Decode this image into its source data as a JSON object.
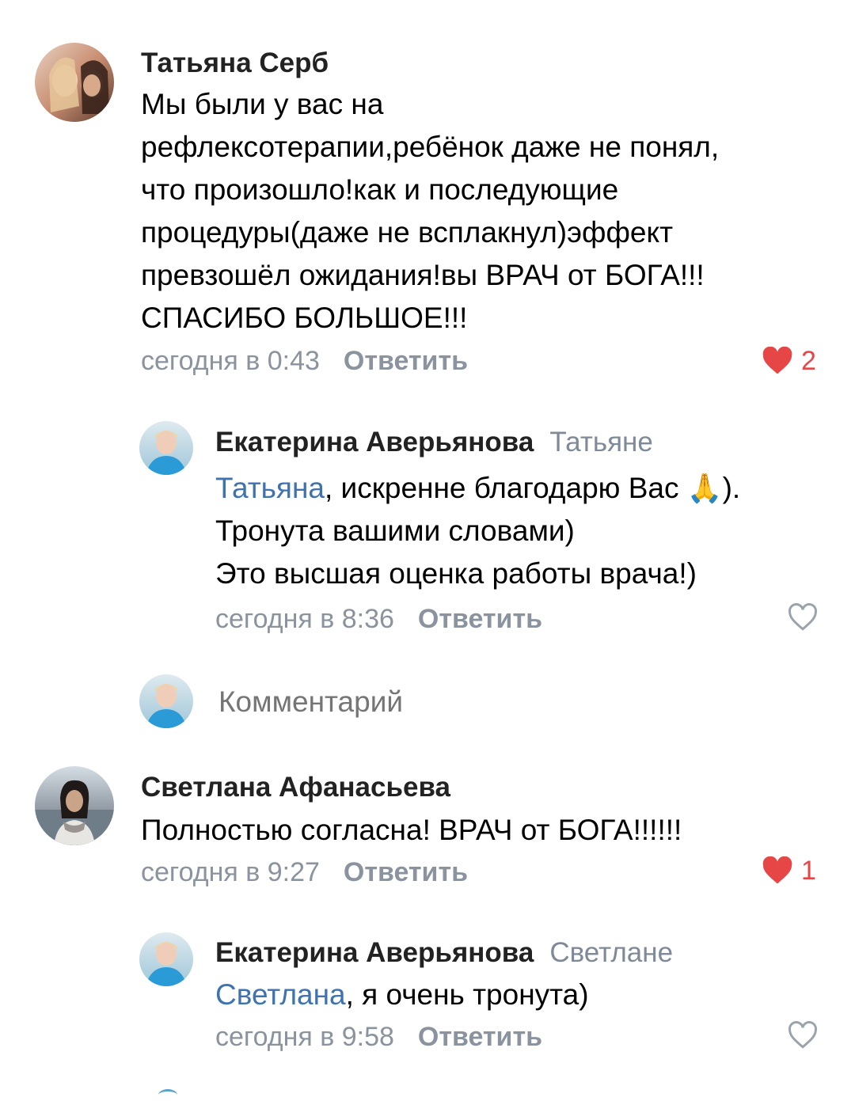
{
  "comments": [
    {
      "author": "Татьяна Серб",
      "text_lines": [
        "Мы были у вас на",
        "рефлексотерапии,ребёнок даже не понял,",
        "что произошло!как и последующие",
        "процедуры(даже не всплакнул)эффект",
        "превзошёл ожидания!вы ВРАЧ от БОГА!!!",
        "СПАСИБО БОЛЬШОЕ!!!"
      ],
      "time": "сегодня в 0:43",
      "reply_label": "Ответить",
      "likes": "2",
      "liked": true,
      "reply": {
        "author": "Екатерина Аверьянова",
        "reply_to": "Татьяне",
        "mention": "Татьяна",
        "line1_rest": ", искренне благодарю Вас ",
        "emoji": "🙏",
        "line1_end": ").",
        "lines": [
          "Тронута вашими словами)",
          "Это высшая оценка работы врача!)"
        ],
        "time": "сегодня в 8:36",
        "reply_label": "Ответить",
        "liked": false
      }
    },
    {
      "author": "Светлана Афанасьева",
      "text_lines": [
        "Полностью согласна! ВРАЧ от БОГА!!!!!!"
      ],
      "time": "сегодня в 9:27",
      "reply_label": "Ответить",
      "likes": "1",
      "liked": true,
      "reply": {
        "author": "Екатерина Аверьянова",
        "reply_to": "Светлане",
        "mention": "Светлана",
        "line1_rest": ", я очень тронута)",
        "time": "сегодня в 9:58",
        "reply_label": "Ответить",
        "liked": false
      }
    }
  ],
  "comment_input": {
    "placeholder": "Комментарий"
  },
  "colors": {
    "like_red": "#e64646",
    "mention_blue": "#3f73b0",
    "meta_gray": "#8a939e"
  }
}
